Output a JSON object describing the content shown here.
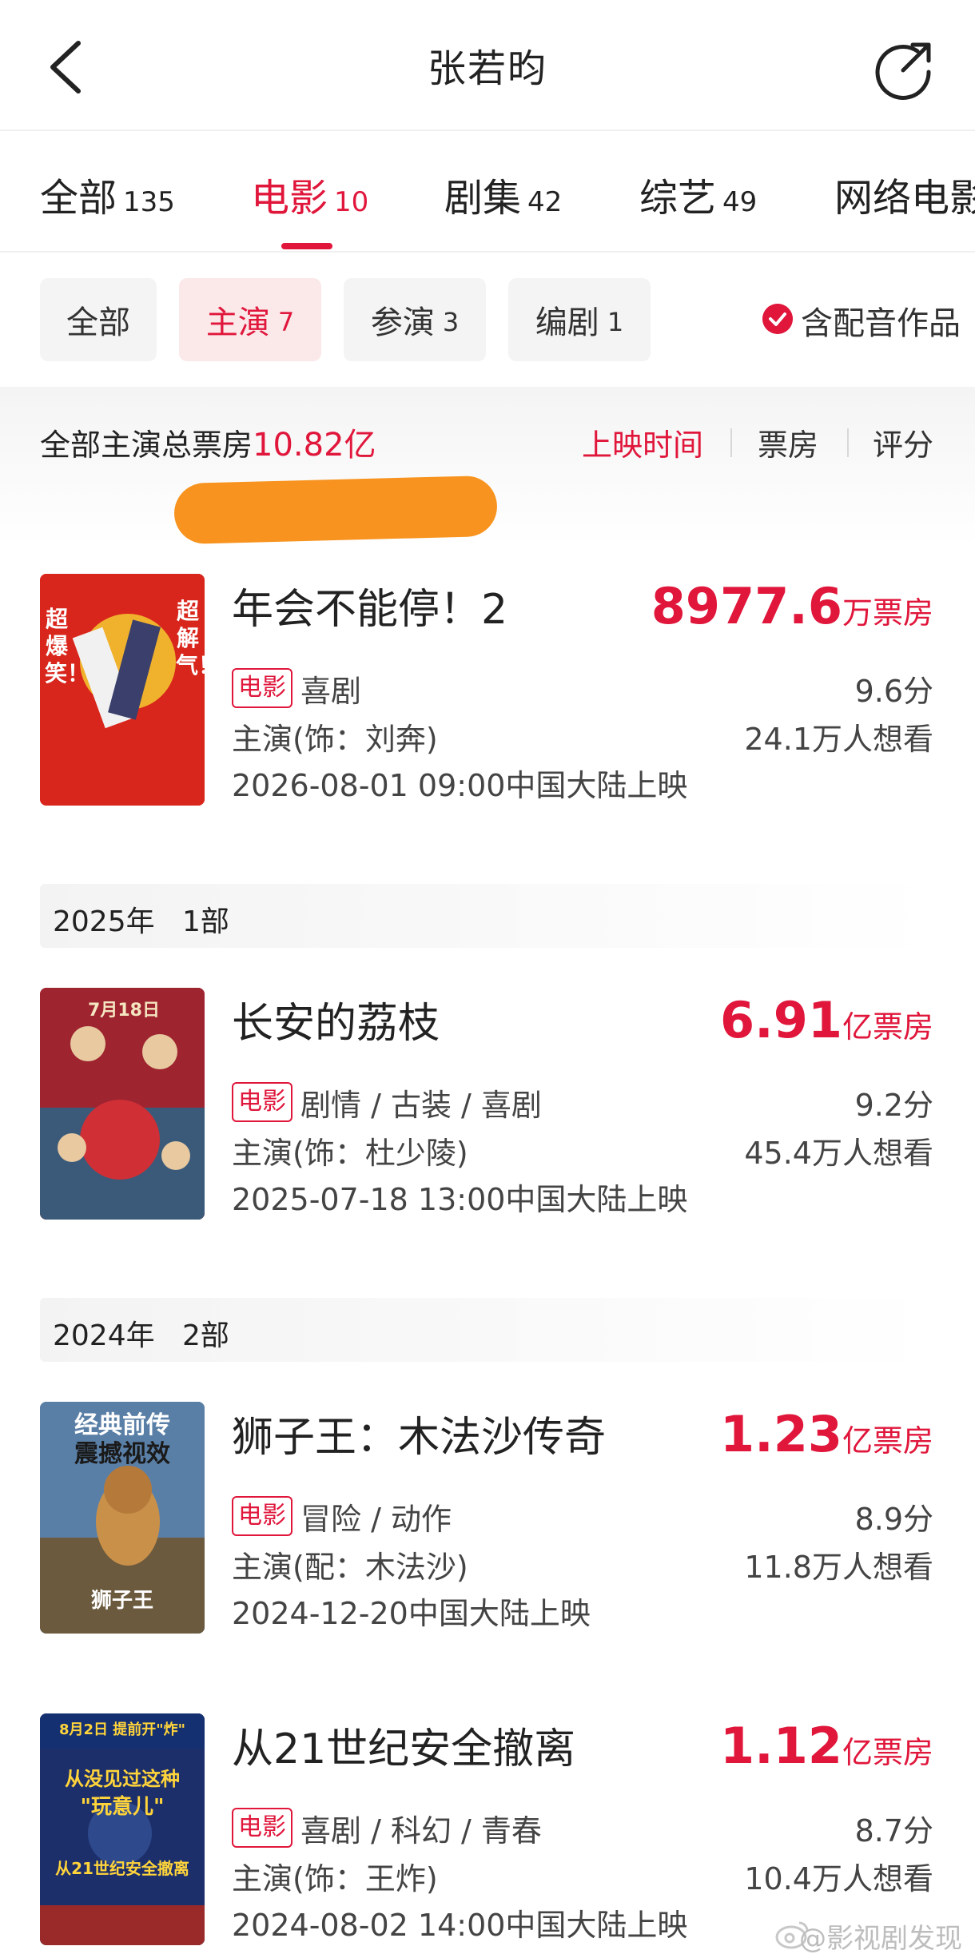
{
  "header": {
    "title": "张若昀"
  },
  "tabs": [
    {
      "label": "全部",
      "count": "135"
    },
    {
      "label": "电影",
      "count": "10"
    },
    {
      "label": "剧集",
      "count": "42"
    },
    {
      "label": "综艺",
      "count": "49"
    },
    {
      "label": "网络电影",
      "count": ""
    }
  ],
  "roles": [
    {
      "label": "全部",
      "count": ""
    },
    {
      "label": "主演",
      "count": "7"
    },
    {
      "label": "参演",
      "count": "3"
    },
    {
      "label": "编剧",
      "count": "1"
    }
  ],
  "dub_filter": {
    "label": "含配音作品",
    "checked": true
  },
  "summary": {
    "label": "全部主演总票房",
    "value": "10.82亿"
  },
  "sort": [
    "上映时间",
    "票房",
    "评分"
  ],
  "movies": [
    {
      "title": "年会不能停！2",
      "box_num": "8977.6",
      "box_unit": "万票房",
      "tag": "电影",
      "genre": "喜剧",
      "score": "9.6分",
      "role": "主演(饰：刘奔)",
      "want": "24.1万人想看",
      "date": "2026-08-01 09:00中国大陆上映",
      "poster_text": [
        "超爆笑！",
        "超解气！"
      ],
      "poster_color": "#d9261c"
    },
    {
      "title": "长安的荔枝",
      "box_num": "6.91",
      "box_unit": "亿票房",
      "tag": "电影",
      "genre": "剧情 / 古装 / 喜剧",
      "score": "9.2分",
      "role": "主演(饰：杜少陵)",
      "want": "45.4万人想看",
      "date": "2025-07-18 13:00中国大陆上映",
      "poster_text": [
        "7月18日"
      ],
      "poster_color": "#b3262f"
    },
    {
      "title": "狮子王：木法沙传奇",
      "box_num": "1.23",
      "box_unit": "亿票房",
      "tag": "电影",
      "genre": "冒险 / 动作",
      "score": "8.9分",
      "role": "主演(配：木法沙)",
      "want": "11.8万人想看",
      "date": "2024-12-20中国大陆上映",
      "poster_text": [
        "经典前传",
        "震撼视效",
        "狮子王"
      ],
      "poster_color": "#4a6b8a"
    },
    {
      "title": "从21世纪安全撤离",
      "box_num": "1.12",
      "box_unit": "亿票房",
      "tag": "电影",
      "genre": "喜剧 / 科幻 / 青春",
      "score": "8.7分",
      "role": "主演(饰：王炸)",
      "want": "10.4万人想看",
      "date": "2024-08-02 14:00中国大陆上映",
      "poster_text": [
        "8月2日 提前开\"炸\"",
        "从没见过这种",
        "\"玩意儿\"",
        "从21世纪安全撤离"
      ],
      "poster_color": "#1d2f6b"
    }
  ],
  "years": [
    {
      "year": "2025年",
      "count": "1部"
    },
    {
      "year": "2024年",
      "count": "2部"
    }
  ],
  "watermark": "@影视剧发现",
  "colors": {
    "accent": "#e0163b",
    "redaction": "#f7931e"
  }
}
